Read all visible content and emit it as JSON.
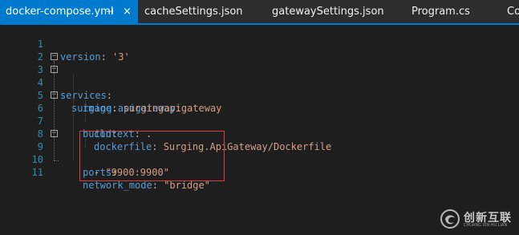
{
  "tabs": [
    {
      "label": "docker-compose.yml",
      "active": true,
      "pin_glyph": "⊣",
      "close_glyph": "×"
    },
    {
      "label": "cacheSettings.json",
      "active": false
    },
    {
      "label": "gatewaySettings.json",
      "active": false
    },
    {
      "label": "Program.cs",
      "active": false
    },
    {
      "label": "Co",
      "active": false
    }
  ],
  "editor": {
    "lines": [
      {
        "number": "1",
        "key": "version",
        "sep": ": ",
        "value": "'3'"
      },
      {
        "number": "2",
        "key": "",
        "sep": "",
        "value": ""
      },
      {
        "number": "3",
        "key": "services",
        "sep": ":",
        "value": "",
        "fold": "−"
      },
      {
        "number": "4",
        "key": "surging.apigateway",
        "sep": ":",
        "value": "",
        "fold": "−"
      },
      {
        "number": "5",
        "key": "image",
        "sep": ": ",
        "value": "surgingapigateway"
      },
      {
        "number": "6",
        "key": "build",
        "sep": ":",
        "value": "",
        "fold": "−"
      },
      {
        "number": "7",
        "key": "context",
        "sep": ": ",
        "value": "."
      },
      {
        "number": "8",
        "key": "dockerfile",
        "sep": ": ",
        "value": "Surging.ApiGateway/Dockerfile"
      },
      {
        "number": "9",
        "key": "ports",
        "sep": ":",
        "value": "",
        "fold": "−"
      },
      {
        "number": "10",
        "key": "",
        "sep": "- ",
        "value": "\"9900:9900\""
      },
      {
        "number": "11",
        "key": "network_mode",
        "sep": ": ",
        "value": "\"bridge\""
      }
    ]
  },
  "watermark": {
    "text": "创新互联",
    "sub": "CHUANG XIN HU LIAN",
    "logo": "circle-swirl-logo"
  },
  "colors": {
    "background": "#1e1e1e",
    "tab_active": "#007acc",
    "line_number": "#2b91af",
    "key": "#569cd6",
    "string": "#d69d85",
    "highlight_box": "#d04040"
  }
}
